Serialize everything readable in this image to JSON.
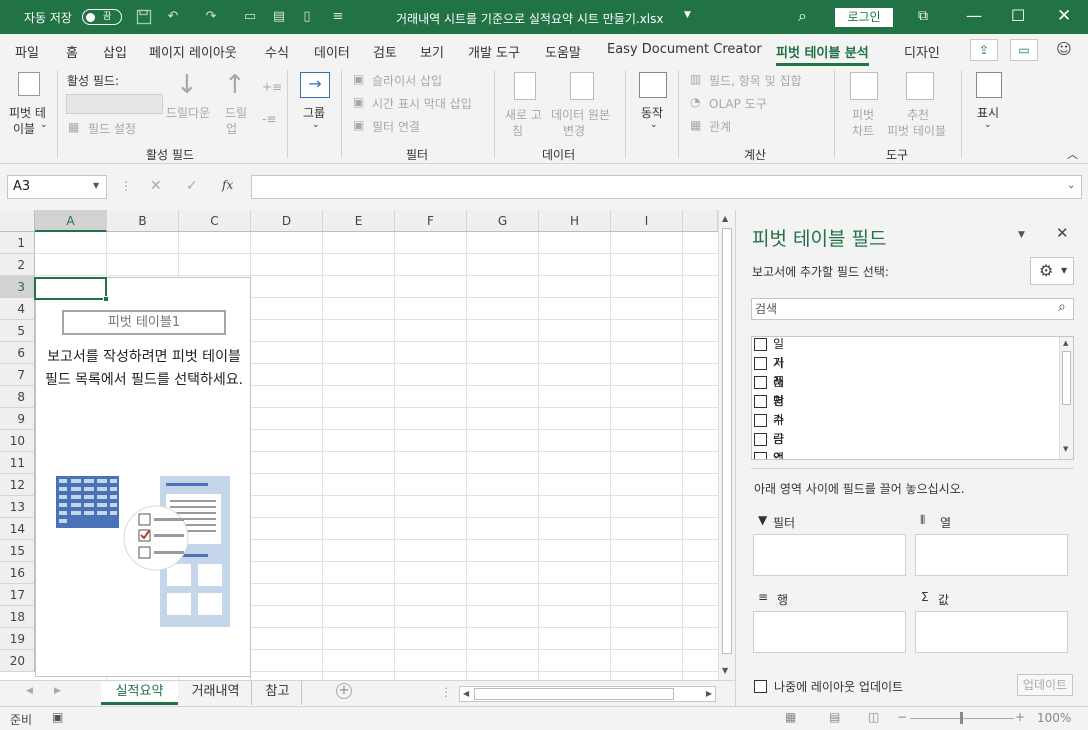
{
  "titlebar": {
    "autosave_label": "자동 저장",
    "autosave_toggle": "끔",
    "filename": "거래내역 시트를 기준으로 실적요약 시트 만들기.xlsx",
    "login": "로그인"
  },
  "menus": [
    "파일",
    "홈",
    "삽입",
    "페이지 레이아웃",
    "수식",
    "데이터",
    "검토",
    "보기",
    "개발 도구",
    "도움말",
    "Easy Document Creator",
    "피벗 테이블 분석",
    "디자인"
  ],
  "ribbon": {
    "pivot_table_line1": "피벗 테",
    "pivot_table_line2": "이블",
    "active_field_label": "활성 필드:",
    "field_settings": "필드 설정",
    "drilldown": "드릴다운",
    "drillup_1": "드릴",
    "drillup_2": "업",
    "group": "그룹",
    "insert_slicer": "슬라이서 삽입",
    "insert_timeline": "시간 표시 막대 삽입",
    "filter_connections": "필터 연결",
    "refresh_1": "새로 고",
    "refresh_2": "침",
    "change_source_1": "데이터 원본",
    "change_source_2": "변경",
    "actions": "동작",
    "fields_items_sets": "필드, 항목 및 집합",
    "olap_tools": "OLAP 도구",
    "relationships": "관계",
    "pivot_chart_1": "피벗",
    "pivot_chart_2": "차트",
    "recommended_1": "추천",
    "recommended_2": "피벗 테이블",
    "show": "표시",
    "groups": {
      "active_field": "활성 필드",
      "filter": "필터",
      "data": "데이터",
      "calculations": "계산",
      "tools": "도구"
    }
  },
  "formula": {
    "namebox": "A3",
    "fx": "fx"
  },
  "columns": [
    "A",
    "B",
    "C",
    "D",
    "E",
    "F",
    "G",
    "H",
    "I"
  ],
  "rows": [
    "1",
    "2",
    "3",
    "4",
    "5",
    "6",
    "7",
    "8",
    "9",
    "10",
    "11",
    "12",
    "13",
    "14",
    "15",
    "16",
    "17",
    "18",
    "19",
    "20"
  ],
  "pivot_placeholder": {
    "title": "피벗 테이블1",
    "message": "보고서를 작성하려면 피벗 테이블 필드 목록에서 필드를 선택하세요."
  },
  "sheets": [
    "실적요약",
    "거래내역",
    "참고"
  ],
  "status": {
    "ready": "준비",
    "zoom": "100%"
  },
  "pane": {
    "title": "피벗 테이블 필드",
    "subtitle": "보고서에 추가할 필드 선택:",
    "search_placeholder": "검색",
    "fields": [
      "일자",
      "거래처",
      "품명",
      "단가",
      "수량",
      "금액",
      "입금액"
    ],
    "drag_hint": "아래 영역 사이에 필드를 끌어 놓으십시오.",
    "areas": {
      "filter": "필터",
      "columns": "열",
      "rows": "행",
      "values": "값"
    },
    "defer_update": "나중에 레이아웃 업데이트",
    "update_button": "업데이트"
  },
  "colors": {
    "brand": "#217346",
    "illustration_blue": "#4a72b8",
    "illustration_light": "#c5d6ea"
  }
}
